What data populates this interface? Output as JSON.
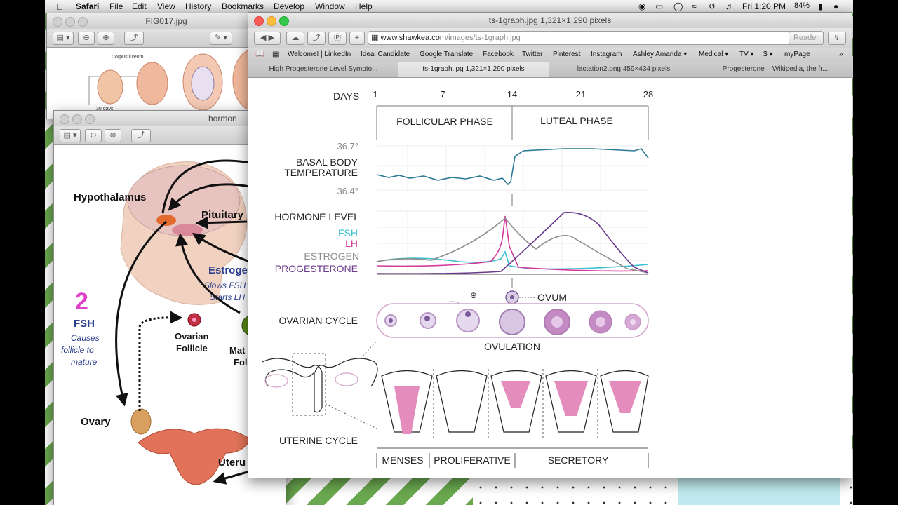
{
  "menubar": {
    "app": "Safari",
    "items": [
      "File",
      "Edit",
      "View",
      "History",
      "Bookmarks",
      "Develop",
      "Window",
      "Help"
    ],
    "battery": "84%",
    "clock": "Fri 1:20 PM"
  },
  "back_window": {
    "title": "FIG017.jpg"
  },
  "back_figure": {
    "caption_top": "Corpus luteum",
    "caption_bottom": "30 days"
  },
  "mid_window": {
    "title": "hormon"
  },
  "diagram": {
    "hypothalamus": "Hypothalamus",
    "pituitary": "Pituitary",
    "estrogen_title": "Estroge",
    "estrogen_line1": "Slows FSH",
    "estrogen_line2": "Starts LH",
    "step_number": "2",
    "fsh_title": "FSH",
    "fsh_line1": "Causes",
    "fsh_line2": "follicle to",
    "fsh_line3": "mature",
    "ovarian_follicle_1": "Ovarian",
    "ovarian_follicle_2": "Follicle",
    "mature_1": "Mat",
    "mature_2": "Fol",
    "ovary": "Ovary",
    "uterus": "Uteru"
  },
  "safari": {
    "title": "ts-1graph.jpg 1,321×1,290 pixels",
    "url_domain": "www.shawkea.com",
    "url_path": "/images/ts-1graph.jpg",
    "reader": "Reader",
    "bookmarks": [
      "Welcome! | LinkedIn",
      "Ideal Candidate",
      "Google Translate",
      "Facebook",
      "Twitter",
      "Pinterest",
      "Instagram",
      "Ashley Amanda ▾",
      "Medical ▾",
      "TV ▾",
      "$ ▾",
      "myPage"
    ],
    "tabs": [
      "High Progesterone Level Sympto...",
      "ts-1graph.jpg 1,321×1,290 pixels",
      "lactation2.png 459×434 pixels",
      "Progesterone – Wikipedia, the fr..."
    ]
  },
  "graph": {
    "days_label": "DAYS",
    "days": [
      "1",
      "7",
      "14",
      "21",
      "28"
    ],
    "follicular": "FOLLICULAR PHASE",
    "luteal": "LUTEAL PHASE",
    "temp_high": "36.7°",
    "temp_low": "36.4°",
    "bbt_1": "BASAL BODY",
    "bbt_2": "TEMPERATURE",
    "hormone_level": "HORMONE LEVEL",
    "fsh": "FSH",
    "lh": "LH",
    "estrogen": "ESTROGEN",
    "progesterone": "PROGESTERONE",
    "ovum": "OVUM",
    "ovarian_cycle": "OVARIAN CYCLE",
    "ovulation": "OVULATION",
    "uterine_cycle": "UTERINE CYCLE",
    "menses": "MENSES",
    "proliferative": "PROLIFERATIVE",
    "secretory": "SECRETORY",
    "colors": {
      "fsh": "#3bbfd0",
      "lh": "#d23a9c",
      "estrogen": "#8c8c8c",
      "progesterone": "#6a3a8c",
      "temperature": "#2c7a96"
    }
  }
}
